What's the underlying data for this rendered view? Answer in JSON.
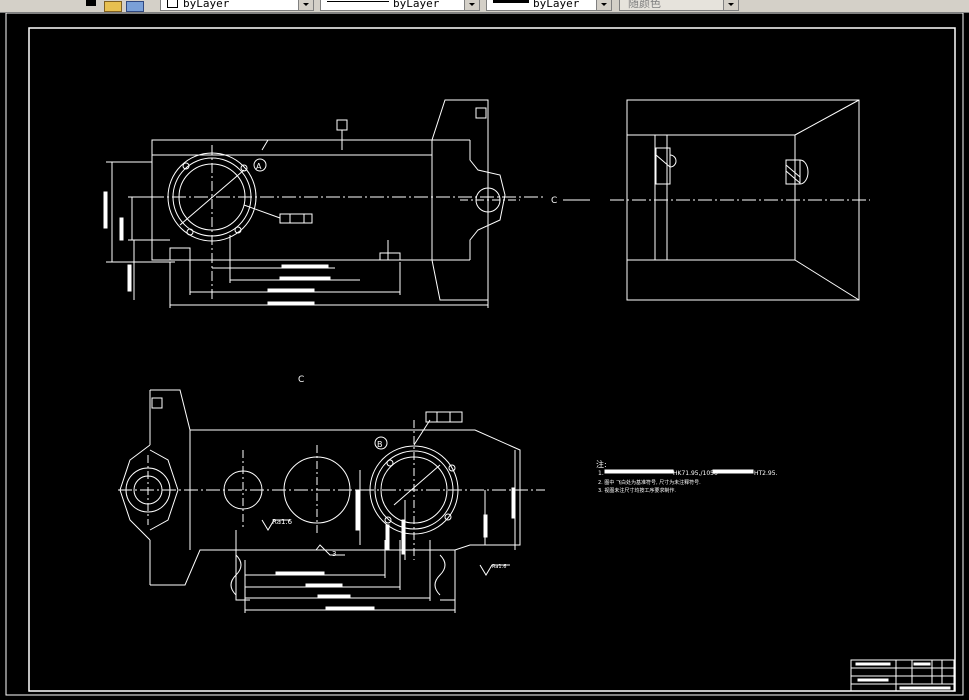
{
  "toolbar": {
    "layer_combo": {
      "value": "byLayer"
    },
    "linetype_combo": {
      "value": "byLayer"
    },
    "lineweight_combo": {
      "value": "byLayer"
    },
    "plotstyle_combo": {
      "value": "随颜色"
    }
  },
  "drawing": {
    "background": "#000000",
    "line_color": "#ffffff",
    "labels": {
      "section_c_top": "C",
      "section_c_bottom": "C",
      "detail_a": "A",
      "detail_b": "B",
      "roughness_1": "Ra1.6",
      "roughness_2": "Ra1.6",
      "datum_3": "3"
    },
    "notes": {
      "title": "注:",
      "line1": "1.",
      "line1_end": "HK71.95,/1050",
      "line1_tail": "HT2.95.",
      "line2": "2. 图中 飞白处为基准符号, 尺寸为未注释符号.",
      "line3": "3. 视图未注尺寸均按工序要求制作."
    }
  }
}
